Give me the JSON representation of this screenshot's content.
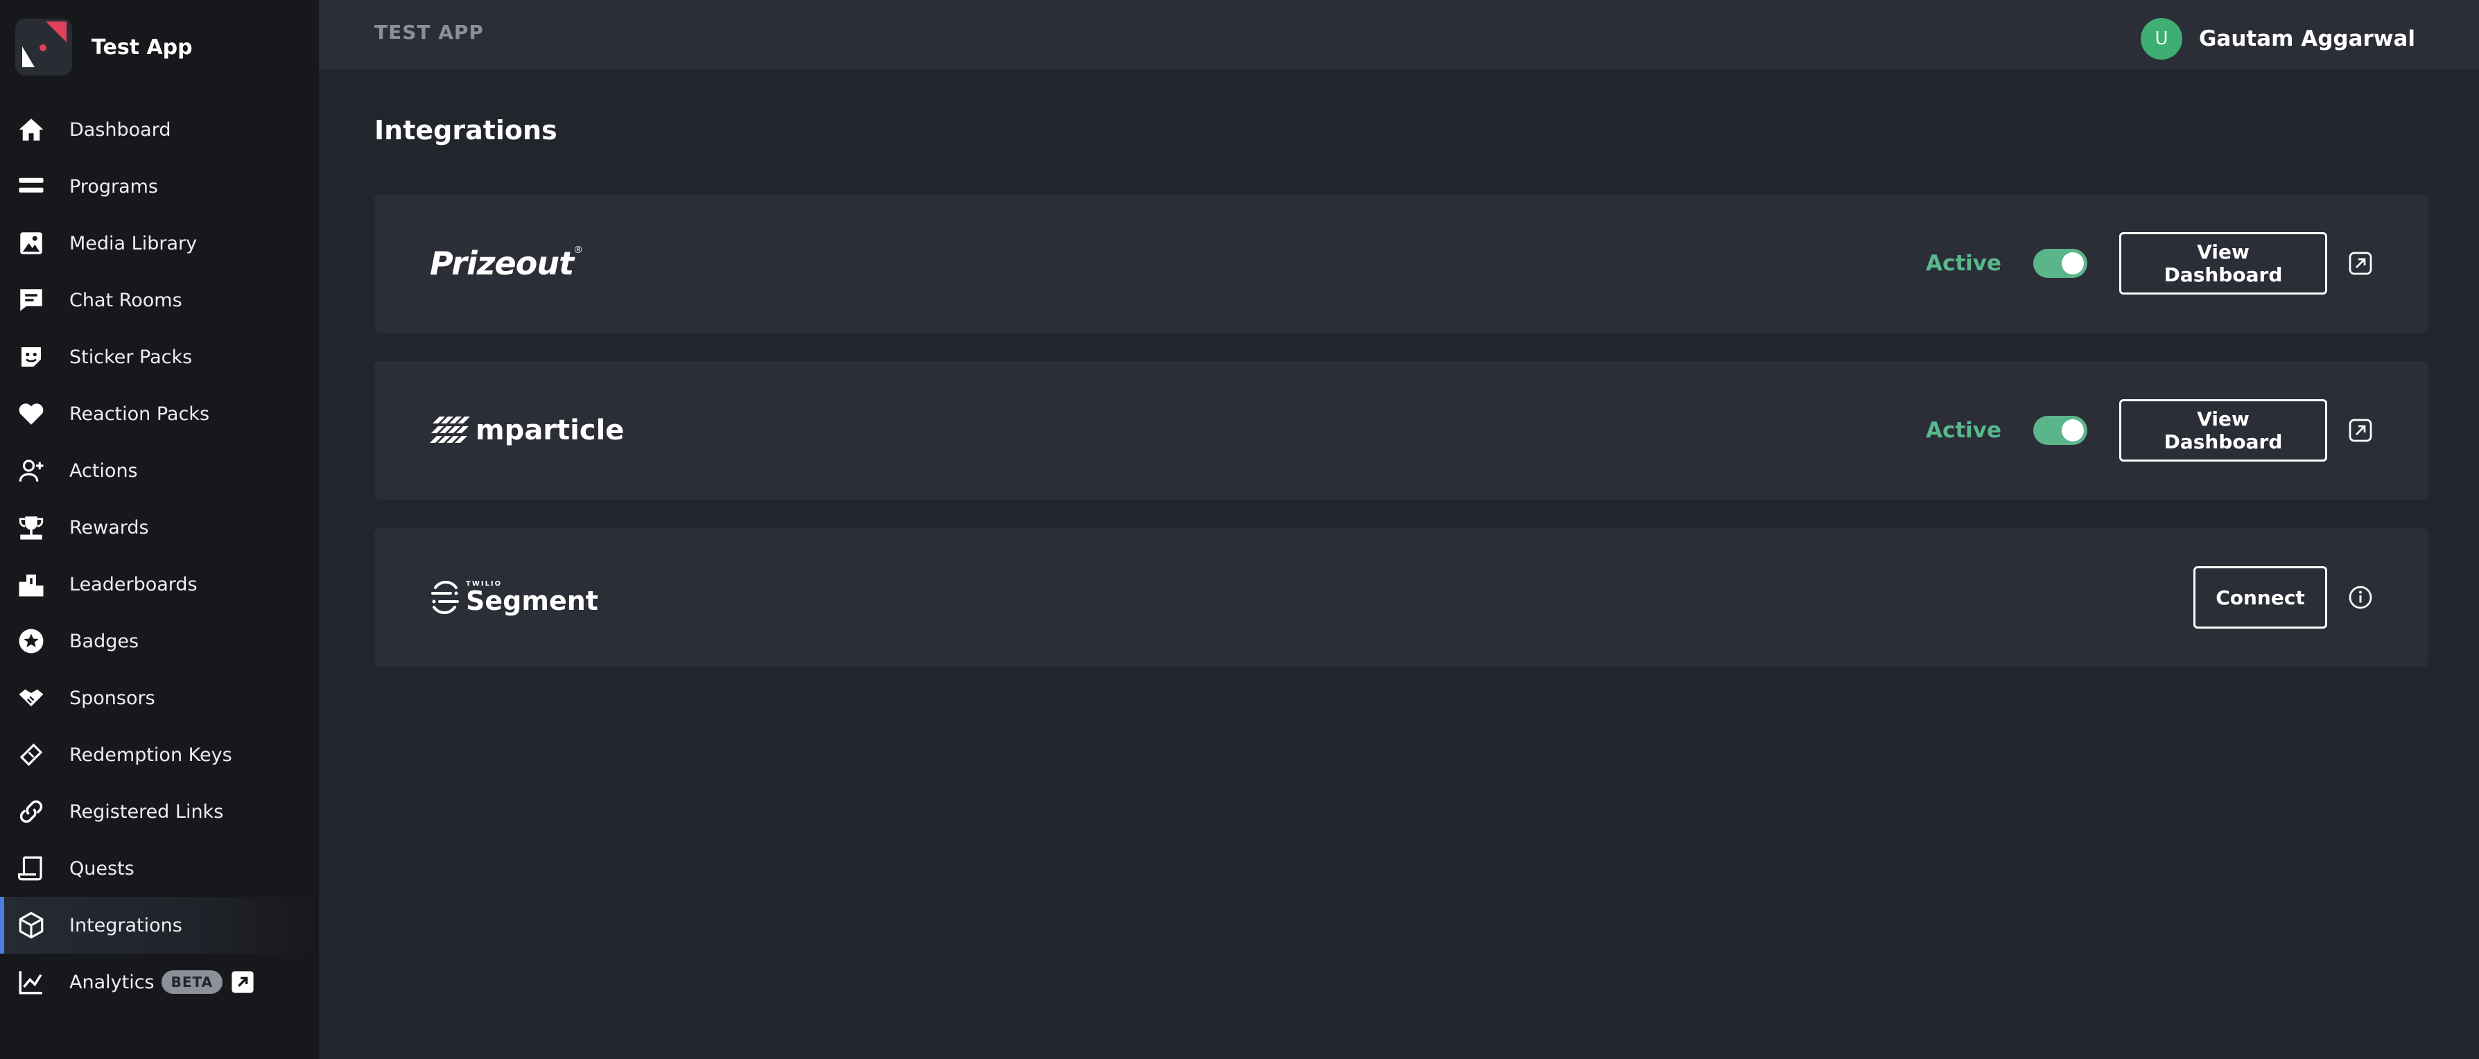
{
  "app": {
    "name": "Test App",
    "topbar_title": "TEST APP"
  },
  "user": {
    "initial": "U",
    "name": "Gautam Aggarwal",
    "avatar_color": "#3fae73"
  },
  "sidebar": {
    "active": "Integrations",
    "accent": "#4a7ddc",
    "items": [
      {
        "label": "Dashboard",
        "icon": "home-icon"
      },
      {
        "label": "Programs",
        "icon": "programs-icon"
      },
      {
        "label": "Media Library",
        "icon": "image-icon"
      },
      {
        "label": "Chat Rooms",
        "icon": "chat-icon"
      },
      {
        "label": "Sticker Packs",
        "icon": "sticker-icon"
      },
      {
        "label": "Reaction Packs",
        "icon": "heart-icon"
      },
      {
        "label": "Actions",
        "icon": "user-plus-icon"
      },
      {
        "label": "Rewards",
        "icon": "trophy-icon"
      },
      {
        "label": "Leaderboards",
        "icon": "podium-icon"
      },
      {
        "label": "Badges",
        "icon": "badge-star-icon"
      },
      {
        "label": "Sponsors",
        "icon": "handshake-icon"
      },
      {
        "label": "Redemption Keys",
        "icon": "ticket-icon"
      },
      {
        "label": "Registered Links",
        "icon": "link-icon"
      },
      {
        "label": "Quests",
        "icon": "scroll-icon"
      },
      {
        "label": "Integrations",
        "icon": "cube-icon"
      },
      {
        "label": "Analytics",
        "icon": "chart-line-icon",
        "badge": "BETA",
        "external": true
      }
    ]
  },
  "main": {
    "title": "Integrations",
    "integrations": [
      {
        "name": "Prizeout",
        "logo_text": "Prizeout",
        "status": "Active",
        "enabled": true,
        "button": "View Dashboard",
        "trail_icon": "external-link-icon"
      },
      {
        "name": "mParticle",
        "logo_text": "mparticle",
        "status": "Active",
        "enabled": true,
        "button": "View Dashboard",
        "trail_icon": "external-link-icon"
      },
      {
        "name": "Segment",
        "logo_text": "Segment",
        "logo_sup": "TWILIO",
        "button": "Connect",
        "trail_icon": "info-icon"
      }
    ]
  },
  "colors": {
    "active_status": "#58b98c",
    "toggle_on": "#5ab58a",
    "panel": "#2b2e36",
    "background": "#22252c",
    "sidebar": "#17181c"
  }
}
